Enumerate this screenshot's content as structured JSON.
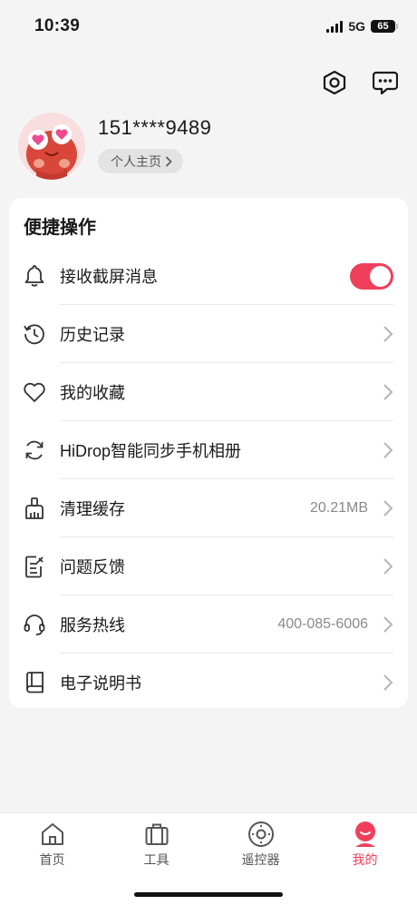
{
  "status_bar": {
    "time": "10:39",
    "network": "5G",
    "battery": "65"
  },
  "profile": {
    "phone": "151****9489",
    "homepage_label": "个人主页"
  },
  "quick_actions": {
    "title": "便捷操作",
    "items": [
      {
        "label": "接收截屏消息",
        "icon": "bell-icon",
        "toggle_on": true
      },
      {
        "label": "历史记录",
        "icon": "history-icon"
      },
      {
        "label": "我的收藏",
        "icon": "heart-icon"
      },
      {
        "label": "HiDrop智能同步手机相册",
        "icon": "sync-icon"
      },
      {
        "label": "清理缓存",
        "icon": "broom-icon",
        "value": "20.21MB"
      },
      {
        "label": "问题反馈",
        "icon": "feedback-icon"
      },
      {
        "label": "服务热线",
        "icon": "headset-icon",
        "value": "400-085-6006"
      },
      {
        "label": "电子说明书",
        "icon": "manual-icon"
      }
    ]
  },
  "tabbar": {
    "tabs": [
      {
        "label": "首页",
        "icon": "home-icon"
      },
      {
        "label": "工具",
        "icon": "toolbox-icon"
      },
      {
        "label": "遥控器",
        "icon": "remote-icon"
      },
      {
        "label": "我的",
        "icon": "profile-icon",
        "active": true
      }
    ]
  },
  "colors": {
    "accent": "#ef3f5b",
    "background": "#f4f4f4",
    "card": "#ffffff"
  }
}
